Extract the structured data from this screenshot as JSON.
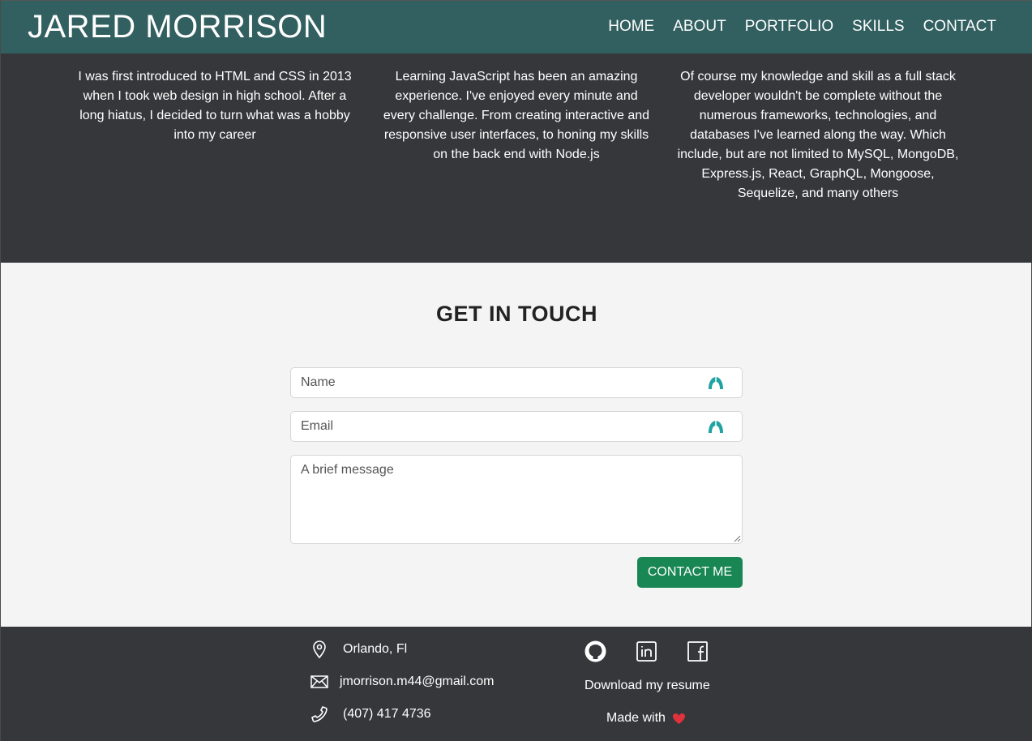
{
  "header": {
    "brand": "JARED MORRISON",
    "nav": [
      "HOME",
      "ABOUT",
      "PORTFOLIO",
      "SKILLS",
      "CONTACT"
    ]
  },
  "about": {
    "col1": "I was first introduced to HTML and CSS in 2013 when I took web design in high school. After a long hiatus, I decided to turn what was a hobby into my career",
    "col2": "Learning JavaScript has been an amazing experience. I've enjoyed every minute and every challenge. From creating interactive and responsive user interfaces, to honing my skills on the back end with Node.js",
    "col3": "Of course my knowledge and skill as a full stack developer wouldn't be complete without the numerous frameworks, technologies, and databases I've learned along the way. Which include, but are not limited to MySQL, MongoDB, Express.js, React, GraphQL, Mongoose, Sequelize, and many others"
  },
  "contact": {
    "title": "GET IN TOUCH",
    "name_placeholder": "Name",
    "email_placeholder": "Email",
    "message_placeholder": "A brief message",
    "submit_label": "CONTACT ME"
  },
  "footer": {
    "location": "Orlando, Fl",
    "email": "jmorrison.m44@gmail.com",
    "phone": "(407) 417 4736",
    "resume_label": "Download my resume",
    "made_with": "Made with",
    "icons": [
      "geo-pin-icon",
      "envelope-icon",
      "telephone-icon",
      "github-icon",
      "linkedin-icon",
      "facebook-icon",
      "heart-icon"
    ]
  },
  "colors": {
    "header_bg": "#325f5f",
    "dark_bg": "#36373b",
    "page_bg": "#f4f4f4",
    "button_green": "#198754",
    "autofill_teal": "#1fa3a3",
    "heart_red": "#e0323c"
  }
}
